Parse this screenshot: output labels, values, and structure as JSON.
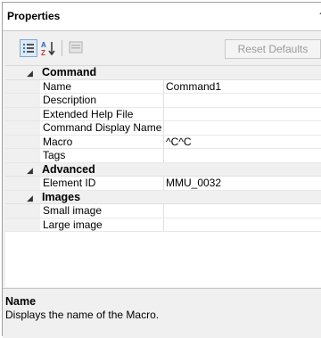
{
  "panel": {
    "title": "Properties"
  },
  "toolbar": {
    "categorized_icon": "categorized-view-icon",
    "alphabetical_icon": "sort-alphabetical-icon",
    "pages_icon": "property-pages-icon",
    "reset_label": "Reset Defaults"
  },
  "categories": [
    {
      "name": "Command",
      "properties": [
        {
          "name": "Name",
          "value": "Command1"
        },
        {
          "name": "Description",
          "value": ""
        },
        {
          "name": "Extended Help File",
          "value": ""
        },
        {
          "name": "Command Display Name",
          "value": ""
        },
        {
          "name": "Macro",
          "value": "^C^C"
        },
        {
          "name": "Tags",
          "value": ""
        }
      ]
    },
    {
      "name": "Advanced",
      "properties": [
        {
          "name": "Element ID",
          "value": "MMU_0032"
        }
      ]
    },
    {
      "name": "Images",
      "properties": [
        {
          "name": "Small image",
          "value": ""
        },
        {
          "name": "Large image",
          "value": ""
        }
      ]
    }
  ],
  "description": {
    "title": "Name",
    "text": "Displays the name of the Macro."
  },
  "colors": {
    "selected_button_border": "#7ea9d8",
    "selected_button_fill": "#dbe9f8",
    "panel_bg": "#f0f0f0"
  }
}
